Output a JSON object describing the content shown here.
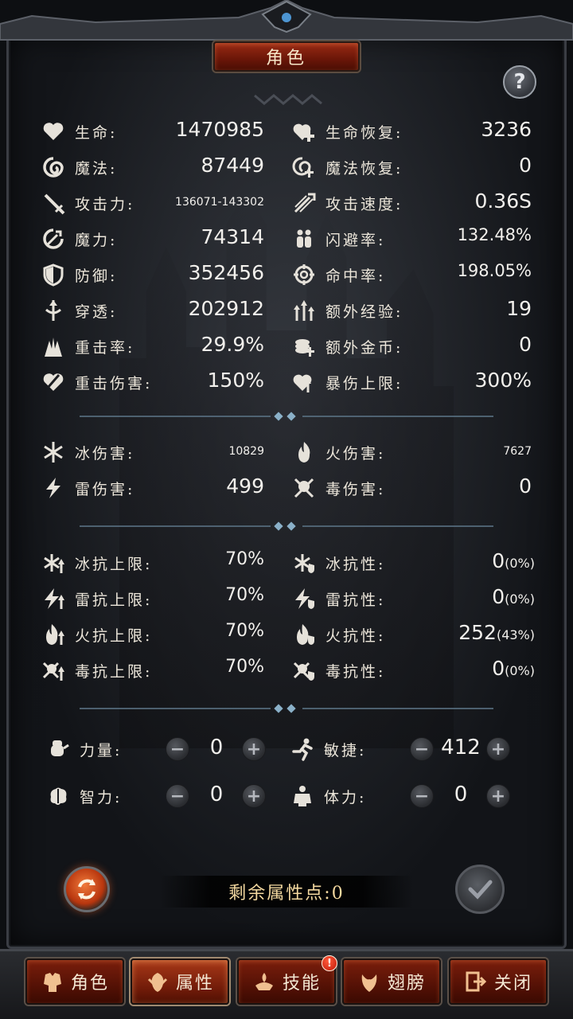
{
  "title": "角色",
  "help_glyph": "?",
  "stats_main": [
    {
      "icon": "heart-icon",
      "label": "生命:",
      "value": "1470985",
      "size": "normal"
    },
    {
      "icon": "heart-plus-icon",
      "label": "生命恢复:",
      "value": "3236",
      "size": "normal"
    },
    {
      "icon": "mana-swirl-icon",
      "label": "魔法:",
      "value": "87449",
      "size": "normal"
    },
    {
      "icon": "mana-regen-icon",
      "label": "魔法恢复:",
      "value": "0",
      "size": "normal"
    },
    {
      "icon": "sword-icon",
      "label": "攻击力:",
      "value": "136071-143302",
      "size": "small"
    },
    {
      "icon": "attack-speed-icon",
      "label": "攻击速度:",
      "value": "0.36S",
      "size": "normal"
    },
    {
      "icon": "magic-power-icon",
      "label": "魔力:",
      "value": "74314",
      "size": "normal"
    },
    {
      "icon": "dodge-icon",
      "label": "闪避率:",
      "value": "132.48%",
      "size": "mid"
    },
    {
      "icon": "shield-icon",
      "label": "防御:",
      "value": "352456",
      "size": "normal"
    },
    {
      "icon": "crosshair-icon",
      "label": "命中率:",
      "value": "198.05%",
      "size": "mid"
    },
    {
      "icon": "penetration-icon",
      "label": "穿透:",
      "value": "202912",
      "size": "normal"
    },
    {
      "icon": "exp-arrows-icon",
      "label": "额外经验:",
      "value": "19",
      "size": "normal"
    },
    {
      "icon": "crit-rate-icon",
      "label": "重击率:",
      "value": "29.9%",
      "size": "normal"
    },
    {
      "icon": "coins-icon",
      "label": "额外金币:",
      "value": "0",
      "size": "normal"
    },
    {
      "icon": "crit-damage-icon",
      "label": "重击伤害:",
      "value": "150%",
      "size": "normal"
    },
    {
      "icon": "crit-cap-icon",
      "label": "暴伤上限:",
      "value": "300%",
      "size": "normal"
    }
  ],
  "stats_element_damage": [
    {
      "icon": "snowflake-icon",
      "label": "冰伤害:",
      "value": "10829",
      "size": "small"
    },
    {
      "icon": "flame-icon",
      "label": "火伤害:",
      "value": "7627",
      "size": "small"
    },
    {
      "icon": "lightning-icon",
      "label": "雷伤害:",
      "value": "499",
      "size": "normal"
    },
    {
      "icon": "poison-icon",
      "label": "毒伤害:",
      "value": "0",
      "size": "normal"
    }
  ],
  "stats_resist": [
    {
      "icon": "ice-cap-icon",
      "label": "冰抗上限:",
      "value": "70%",
      "size": "mid-lg"
    },
    {
      "icon": "ice-resist-icon",
      "label": "冰抗性:",
      "value": "0",
      "pct": "(0%)",
      "size": "normal"
    },
    {
      "icon": "lightning-cap-icon",
      "label": "雷抗上限:",
      "value": "70%",
      "size": "mid-lg"
    },
    {
      "icon": "lightning-resist-icon",
      "label": "雷抗性:",
      "value": "0",
      "pct": "(0%)",
      "size": "normal"
    },
    {
      "icon": "fire-cap-icon",
      "label": "火抗上限:",
      "value": "70%",
      "size": "mid-lg"
    },
    {
      "icon": "fire-resist-icon",
      "label": "火抗性:",
      "value": "252",
      "pct": "(43%)",
      "size": "normal"
    },
    {
      "icon": "poison-cap-icon",
      "label": "毒抗上限:",
      "value": "70%",
      "size": "mid-lg"
    },
    {
      "icon": "poison-resist-icon",
      "label": "毒抗性:",
      "value": "0",
      "pct": "(0%)",
      "size": "normal"
    }
  ],
  "attributes": [
    {
      "icon": "fist-icon",
      "label": "力量:",
      "value": "0"
    },
    {
      "icon": "runner-icon",
      "label": "敏捷:",
      "value": "412"
    },
    {
      "icon": "brain-icon",
      "label": "智力:",
      "value": "0"
    },
    {
      "icon": "body-icon",
      "label": "体力:",
      "value": "0"
    }
  ],
  "minus_glyph": "−",
  "plus_glyph": "+",
  "remaining_points": "剩余属性点:0",
  "tabs": [
    {
      "icon": "armor-icon",
      "label": "角色",
      "active": false
    },
    {
      "icon": "attribute-icon",
      "label": "属性",
      "active": true
    },
    {
      "icon": "skill-icon",
      "label": "技能",
      "active": false
    },
    {
      "icon": "wings-icon",
      "label": "翅膀",
      "active": false
    },
    {
      "icon": "exit-icon",
      "label": "关闭",
      "active": false
    }
  ],
  "skill_badge": "!",
  "colors": {
    "accent_red": "#8a2410",
    "text_light": "#ece6da",
    "gold_text": "#f4d9a0"
  }
}
